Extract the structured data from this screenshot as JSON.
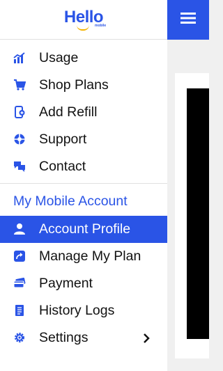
{
  "brand": {
    "logo_text": "Hello",
    "logo_subtext": "mobile",
    "accent_color": "#2a54e6"
  },
  "menu_button": {
    "icon": "hamburger-menu-icon"
  },
  "nav": {
    "main_items": [
      {
        "label": "Usage",
        "icon": "bar-chart-icon"
      },
      {
        "label": "Shop Plans",
        "icon": "shopping-cart-icon"
      },
      {
        "label": "Add Refill",
        "icon": "phone-refill-icon"
      },
      {
        "label": "Support",
        "icon": "lifebuoy-icon"
      },
      {
        "label": "Contact",
        "icon": "chat-bubbles-icon"
      }
    ],
    "section_heading": "My Mobile Account",
    "account_items": [
      {
        "label": "Account Profile",
        "icon": "user-icon",
        "active": true
      },
      {
        "label": "Manage My Plan",
        "icon": "share-arrow-icon"
      },
      {
        "label": "Payment",
        "icon": "credit-cards-icon"
      },
      {
        "label": "History Logs",
        "icon": "document-list-icon"
      },
      {
        "label": "Settings",
        "icon": "gear-icon",
        "has_submenu": true
      }
    ]
  }
}
